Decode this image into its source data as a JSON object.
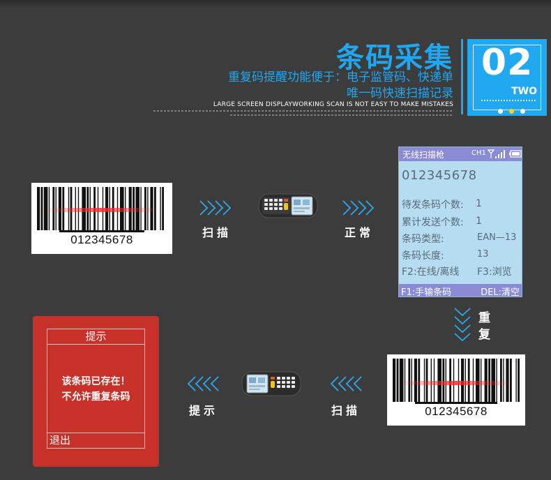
{
  "header": {
    "title": "条码采集",
    "subtitle_line1": "重复码提醒功能便于：电子监管码、快递单",
    "subtitle_line2": "唯一码快速扫描记录",
    "tagline": "LARGE SCREEN DISPLAYWORKING SCAN IS NOT EASY TO MAKE MISTAKES"
  },
  "badge": {
    "number": "02",
    "word": "TWO",
    "color": "#20a8f0",
    "dot_colors": [
      "#ffffff",
      "#ffd21f",
      "#ffffff"
    ]
  },
  "flow": {
    "barcode_number": "012345678",
    "step_scan": "扫描",
    "step_normal": "正常",
    "step_repeat": "重复",
    "step_prompt": "提示"
  },
  "screen": {
    "title": "无线扫描枪",
    "channel": "CH1",
    "code": "012345678",
    "pending_label": "待发条码个数:",
    "pending_value": "1",
    "sent_label": "累计发送个数:",
    "sent_value": "1",
    "type_label": "条码类型:",
    "type_value": "EAN—13",
    "length_label": "条码长度:",
    "length_value": "13",
    "f2_hint": "F2:在线/离线",
    "f3_hint": "F3:浏览",
    "f1_hint": "F1:手输条码",
    "del_hint": "DEL:清空",
    "header_color": "#8b8ad4",
    "background_color": "#b6dcf1"
  },
  "alert": {
    "title": "提示",
    "message_line1": "该条码已存在！",
    "message_line2": "不允许重复条码",
    "exit_label": "退出",
    "color": "#c8302a"
  },
  "icons": [
    "chevron-right-icon",
    "chevron-down-icon",
    "chevron-left-icon",
    "signal-icon",
    "battery-icon",
    "handheld-scanner-icon"
  ]
}
